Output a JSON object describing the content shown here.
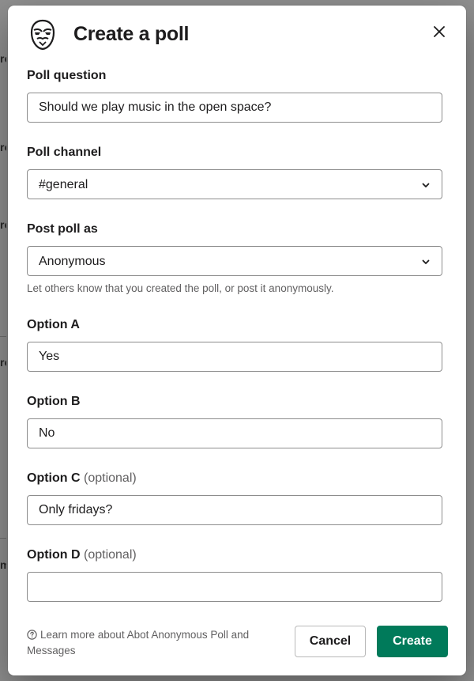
{
  "modal": {
    "title": "Create a poll"
  },
  "fields": {
    "question": {
      "label": "Poll question",
      "value": "Should we play music in the open space?"
    },
    "channel": {
      "label": "Poll channel",
      "value": "#general"
    },
    "post_as": {
      "label": "Post poll as",
      "value": "Anonymous",
      "hint": "Let others know that you created the poll, or post it anonymously."
    },
    "option_a": {
      "label": "Option A",
      "value": "Yes"
    },
    "option_b": {
      "label": "Option B",
      "value": "No"
    },
    "option_c": {
      "label": "Option C",
      "optional": "(optional)",
      "value": "Only fridays?"
    },
    "option_d": {
      "label": "Option D",
      "optional": "(optional)",
      "value": ""
    }
  },
  "footer": {
    "help_text": "Learn more about Abot Anonymous Poll and Messages",
    "cancel_label": "Cancel",
    "create_label": "Create"
  },
  "colors": {
    "primary": "#007a5a",
    "text": "#1d1c1d",
    "muted": "#616061",
    "border": "#8d8d8d"
  },
  "icons": {
    "logo": "anonymous-mask-icon",
    "close": "close-icon",
    "dropdown": "chevron-down-icon",
    "help": "help-circle-icon"
  }
}
